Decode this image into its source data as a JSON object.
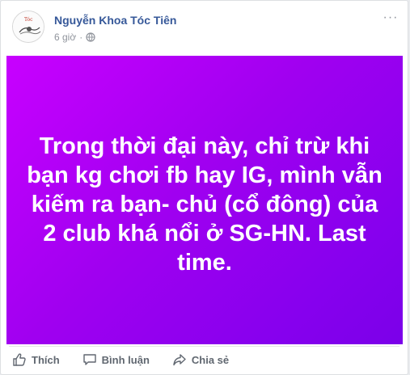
{
  "post": {
    "author": "Nguyễn Khoa Tóc Tiên",
    "time": "6 giờ",
    "text": "Trong thời đại này, chỉ trừ khi bạn kg chơi fb hay IG, mình vẫn kiếm ra bạn- chủ (cổ đông) của 2 club khá nổi ở SG-HN. Last time.",
    "background_colors": [
      "#c800ff",
      "#7b00e9"
    ],
    "more_label": "···"
  },
  "actions": {
    "like": "Thích",
    "comment": "Bình luận",
    "share": "Chia sẻ"
  },
  "icons": {
    "privacy": "globe-icon",
    "more": "more-options-icon",
    "like": "thumbs-up-icon",
    "comment": "comment-icon",
    "share": "share-arrow-icon"
  }
}
